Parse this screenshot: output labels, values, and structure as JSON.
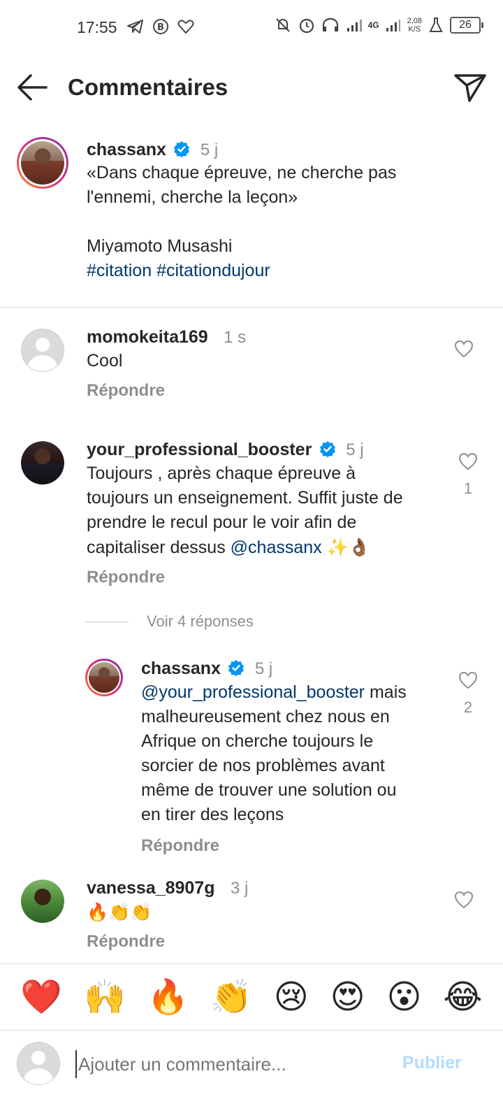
{
  "status_bar": {
    "time": "17:55",
    "network": "4G",
    "speed_value": "2,08",
    "speed_unit": "K/S",
    "battery": "26"
  },
  "header": {
    "title": "Commentaires",
    "icons": [
      "back-arrow-icon",
      "direct-send-icon"
    ]
  },
  "caption": {
    "username": "chassanx",
    "verified": true,
    "time": "5 j",
    "text_line1": "«Dans chaque épreuve, ne cherche pas",
    "text_line2": "l'ennemi, cherche la leçon»",
    "author": "Miyamoto Musashi",
    "hashtag1": "#citation",
    "hashtag2": "#citationdujour"
  },
  "comments": [
    {
      "username": "momokeita169",
      "time": "1 s",
      "text": "Cool",
      "reply_label": "Répondre",
      "likes": ""
    },
    {
      "username": "your_professional_booster",
      "verified": true,
      "time": "5 j",
      "text_line1": "Toujours , après chaque épreuve à",
      "text_line2": "toujours un enseignement. Suffit juste de",
      "text_line3": "prendre le recul pour le voir afin de",
      "text_line4_prefix": "capitaliser dessus ",
      "mention": "@chassanx",
      "emojis": "✨👌🏾",
      "reply_label": "Répondre",
      "likes": "1"
    },
    {
      "username": "vanessa_8907g",
      "time": "3 j",
      "text": "🔥👏👏",
      "reply_label": "Répondre",
      "likes": ""
    }
  ],
  "view_replies": "Voir 4 réponses",
  "reply": {
    "username": "chassanx",
    "verified": true,
    "time": "5 j",
    "mention": "@your_professional_booster",
    "text_line1_suffix": " mais",
    "text_line2": "malheureusement chez nous en",
    "text_line3": "Afrique on cherche toujours le",
    "text_line4": "sorcier de nos problèmes avant",
    "text_line5": "même de trouver une solution ou",
    "text_line6": "en tirer des leçons",
    "reply_label": "Répondre",
    "likes": "2"
  },
  "emoji_bar": [
    "❤️",
    "🙌",
    "🔥",
    "👏",
    "😢",
    "😍",
    "😮",
    "😂"
  ],
  "composer": {
    "placeholder": "Ajouter un commentaire...",
    "publish": "Publier"
  },
  "colors": {
    "link": "#00376b",
    "muted": "#8e8e8e",
    "verified": "#0095f6",
    "publish_disabled": "#b3dbff"
  }
}
